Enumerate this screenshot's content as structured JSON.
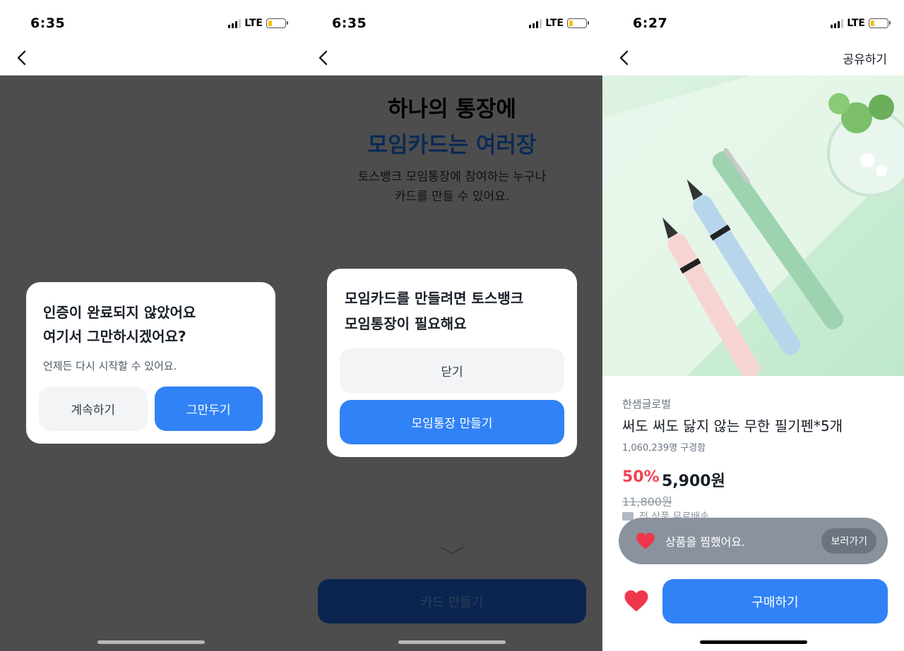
{
  "screens": [
    {
      "status": {
        "time": "6:35",
        "network": "LTE"
      },
      "dialog": {
        "title_line1": "인증이 완료되지 않았어요",
        "title_line2": "여기서 그만하시겠어요?",
        "description": "언제든 다시 시작할 수 있어요.",
        "secondary_label": "계속하기",
        "primary_label": "그만두기"
      }
    },
    {
      "status": {
        "time": "6:35",
        "network": "LTE"
      },
      "headline_line1": "하나의 통장에",
      "headline_line2": "모임카드는 여러장",
      "subtitle_line1": "토스뱅크 모임통장에 참여하는 누구나",
      "subtitle_line2": "카드를 만들 수 있어요.",
      "dialog": {
        "title_line1": "모임카드를 만들려면 토스뱅크",
        "title_line2": "모임통장이 필요해요",
        "close_label": "닫기",
        "primary_label": "모임통장 만들기"
      },
      "bottom_button": "카드 만들기"
    },
    {
      "status": {
        "time": "6:27",
        "network": "LTE"
      },
      "nav": {
        "share_label": "공유하기"
      },
      "product": {
        "brand": "한샘글로벌",
        "name": "써도 써도 닳지 않는 무한 필기펜*5개",
        "buyers": "1,060,239명 구경함",
        "discount": "50%",
        "price": "5,900원",
        "original_price": "11,800원",
        "shipping": "전 상품 무료배송"
      },
      "toast": {
        "message": "상품을 찜했어요.",
        "action_label": "보러가기"
      },
      "buy_label": "구매하기"
    }
  ],
  "colors": {
    "primary_blue": "#3182f6",
    "discount_red": "#f04452",
    "heart_red": "#f0364a",
    "dim_overlay": "#4d4d4d"
  }
}
